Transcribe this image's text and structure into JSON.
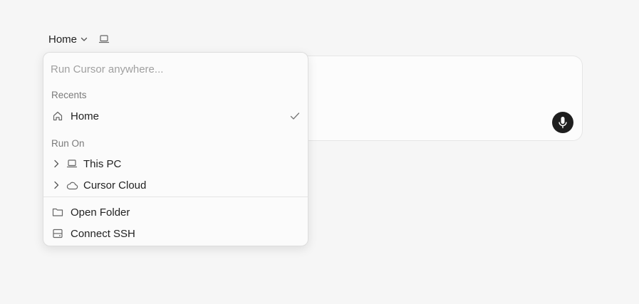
{
  "header": {
    "location_label": "Home",
    "location_icon": "chevron-down-icon",
    "device_icon": "laptop-icon"
  },
  "dropdown": {
    "search_placeholder": "Run Cursor anywhere...",
    "recents_label": "Recents",
    "recents": [
      {
        "label": "Home",
        "icon": "home-icon",
        "selected": true
      }
    ],
    "run_on_label": "Run On",
    "run_on": [
      {
        "label": "This PC",
        "icon": "laptop-icon"
      },
      {
        "label": "Cursor Cloud",
        "icon": "cloud-icon"
      }
    ],
    "actions": [
      {
        "label": "Open Folder",
        "icon": "folder-icon"
      },
      {
        "label": "Connect SSH",
        "icon": "server-icon"
      }
    ]
  },
  "composer": {
    "mic_icon": "microphone-icon"
  },
  "colors": {
    "background": "#f6f6f6",
    "panel": "#fbfbfb",
    "mic_button": "#1e1e1e"
  }
}
